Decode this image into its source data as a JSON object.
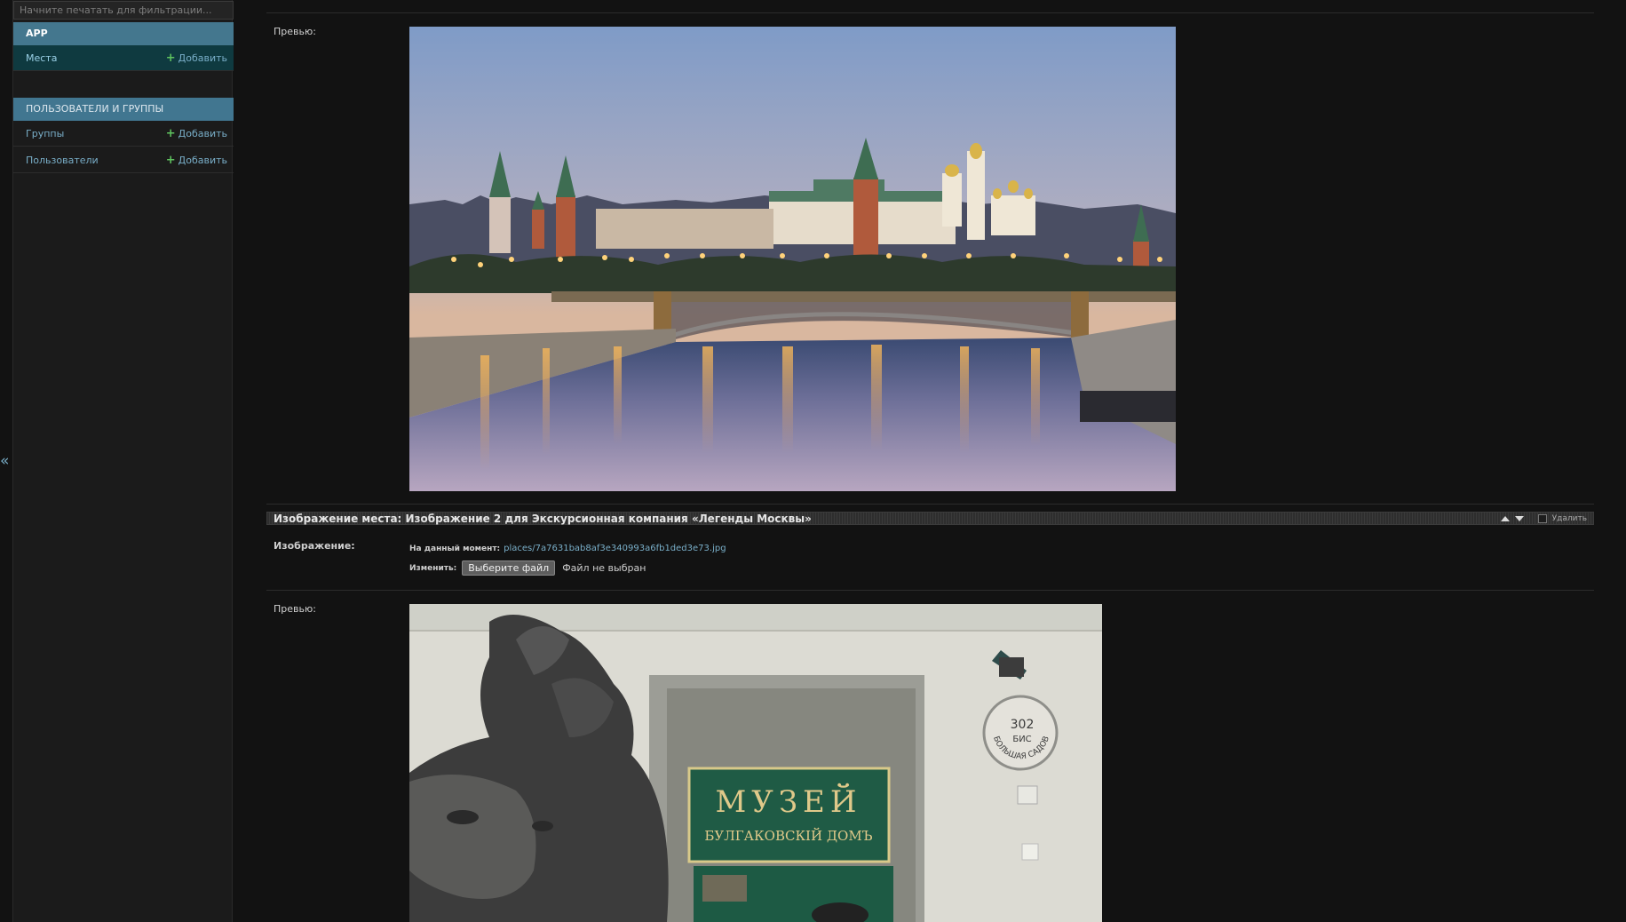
{
  "sidebar": {
    "filter_placeholder": "Начните печатать для фильтрации...",
    "modules": [
      {
        "caption": "APP",
        "models": [
          {
            "name": "Места",
            "add_label": "Добавить"
          }
        ]
      },
      {
        "caption": "ПОЛЬЗОВАТЕЛИ И ГРУППЫ",
        "models": [
          {
            "name": "Группы",
            "add_label": "Добавить"
          },
          {
            "name": "Пользователи",
            "add_label": "Добавить"
          }
        ]
      }
    ],
    "collapse_glyph": "«",
    "add_glyph": "+"
  },
  "main": {
    "preview_label_1": "Превью:",
    "inline": {
      "title": "Изображение места: Изображение 2 для Экскурсионная компания «Легенды Москвы»",
      "delete_label": "Удалить",
      "image_label": "Изображение:",
      "current_label": "На данный момент:",
      "current_file": "places/7a7631bab8af3e340993a6fb1ded3e73.jpg",
      "change_label": "Изменить:",
      "choose_button": "Выберите файл",
      "no_file_text": "Файл не выбран",
      "preview_label": "Превью:"
    },
    "museum_sign": {
      "line1": "МУЗЕЙ",
      "line2": "БУЛГАКОВСКIЙ ДОМЪ"
    },
    "museum_plaque": {
      "number": "302",
      "sub": "БИС",
      "arc": "БОЛЬШАЯ САДОВАЯ"
    }
  },
  "colors": {
    "accent_link": "#79aec8",
    "module_header": "#44778e",
    "add_plus": "#5fc35f",
    "background": "#121212"
  },
  "icons": {
    "collapse": "double-chevron-left-icon",
    "add": "plus-icon",
    "move_up": "triangle-up-icon",
    "move_down": "triangle-down-icon"
  }
}
